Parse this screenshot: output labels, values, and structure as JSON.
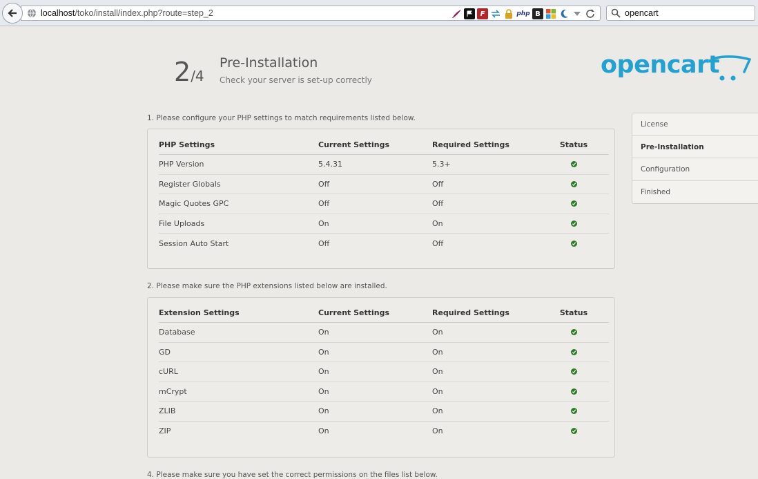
{
  "browser": {
    "url_host": "localhost",
    "url_path": "/toko/install/index.php?route=step_2",
    "search_value": "opencart",
    "icons": [
      "back-arrow-icon",
      "globe-icon",
      "feather-icon",
      "flag-icon",
      "f-addon-icon",
      "transfer-icon",
      "lock-icon",
      "php-icon",
      "b-icon",
      "windows-icon",
      "moon-icon",
      "dropdown-icon",
      "reload-icon",
      "search-icon"
    ],
    "php_label": "php",
    "b_label": "B",
    "f_label": "F"
  },
  "header": {
    "step_current": "2",
    "step_total": "/4",
    "title": "Pre-Installation",
    "subtitle": "Check your server is set-up correctly",
    "logo_text": "opencart",
    "brand_color": "#23a1d1"
  },
  "section1": {
    "label": "1. Please configure your PHP settings to match requirements listed below.",
    "headers": [
      "PHP Settings",
      "Current Settings",
      "Required Settings",
      "Status"
    ],
    "rows": [
      [
        "PHP Version",
        "5.4.31",
        "5.3+"
      ],
      [
        "Register Globals",
        "Off",
        "Off"
      ],
      [
        "Magic Quotes GPC",
        "Off",
        "Off"
      ],
      [
        "File Uploads",
        "On",
        "On"
      ],
      [
        "Session Auto Start",
        "Off",
        "Off"
      ]
    ]
  },
  "section2": {
    "label": "2. Please make sure the PHP extensions listed below are installed.",
    "headers": [
      "Extension Settings",
      "Current Settings",
      "Required Settings",
      "Status"
    ],
    "rows": [
      [
        "Database",
        "On",
        "On"
      ],
      [
        "GD",
        "On",
        "On"
      ],
      [
        "cURL",
        "On",
        "On"
      ],
      [
        "mCrypt",
        "On",
        "On"
      ],
      [
        "ZLIB",
        "On",
        "On"
      ],
      [
        "ZIP",
        "On",
        "On"
      ]
    ]
  },
  "section4": {
    "label": "4. Please make sure you have set the correct permissions on the files list below."
  },
  "sidebar": {
    "items": [
      {
        "label": "License",
        "active": false
      },
      {
        "label": "Pre-Installation",
        "active": true
      },
      {
        "label": "Configuration",
        "active": false
      },
      {
        "label": "Finished",
        "active": false
      }
    ]
  },
  "status_color": "#2f7a2a"
}
